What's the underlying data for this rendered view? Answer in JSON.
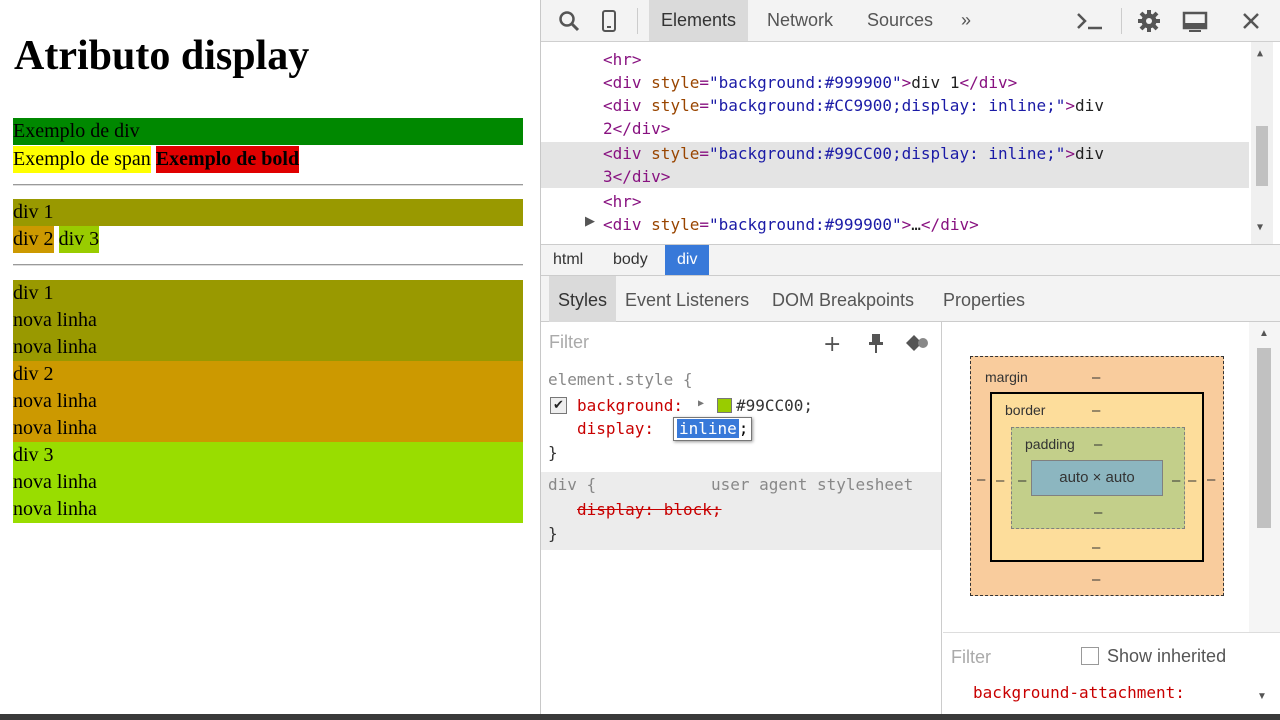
{
  "page": {
    "title": "Atributo display",
    "row1": {
      "div": "Exemplo de div",
      "span": "Exemplo de span",
      "bold": "Exemplo de bold"
    },
    "row2": {
      "div1": "div 1",
      "div2": "div 2",
      "div3": "div 3"
    },
    "row3": {
      "div1": "div 1",
      "div2": "div 2",
      "div3": "div 3",
      "nova_linha": "nova linha"
    },
    "colors": {
      "green": "#008800",
      "yellow": "#ffff00",
      "red": "#e00000",
      "olive": "#999900",
      "orange": "#cc9900",
      "lime": "#99cc00"
    }
  },
  "devtools": {
    "tabs": [
      "Elements",
      "Network",
      "Sources"
    ],
    "more": "»",
    "active_tab": "Elements",
    "dom_lines": {
      "l0": "<hr>",
      "l1_tag": "<div ",
      "l1_attr": "style",
      "l1_val": "\"background:#999900\"",
      "l1_text": "div 1",
      "l1_close": "</div>",
      "l2_val": "\"background:#CC9900;display: inline;\"",
      "l2_text": "div",
      "l2_cont": "2</div>",
      "l3_val": "\"background:#99CC00;display: inline;\"",
      "l3_text": "div",
      "l3_cont": "3</div>",
      "l4": "<hr>",
      "l5_val": "\"background:#999900\"",
      "l5_text": "…",
      "l5_close": "</div>"
    },
    "breadcrumbs": [
      "html",
      "body",
      "div"
    ],
    "subtabs": [
      "Styles",
      "Event Listeners",
      "DOM Breakpoints",
      "Properties"
    ],
    "styles": {
      "filter_placeholder": "Filter",
      "element_style": "element.style {",
      "bg_prop": "background:",
      "bg_value": "#99CC00;",
      "display_prop": "display:",
      "display_value": "inline",
      "display_semi": ";",
      "close": "}",
      "div_selector": "div {",
      "ua_label": "user agent stylesheet",
      "ua_rule": "display: block;",
      "swatch_color": "#99cc00"
    },
    "box_model": {
      "margin": "margin",
      "border": "border",
      "padding": "padding",
      "content": "auto × auto",
      "dash": "–"
    },
    "computed": {
      "filter_placeholder": "Filter",
      "show_inherited": "Show inherited",
      "first_prop": "background-attachment:"
    }
  }
}
